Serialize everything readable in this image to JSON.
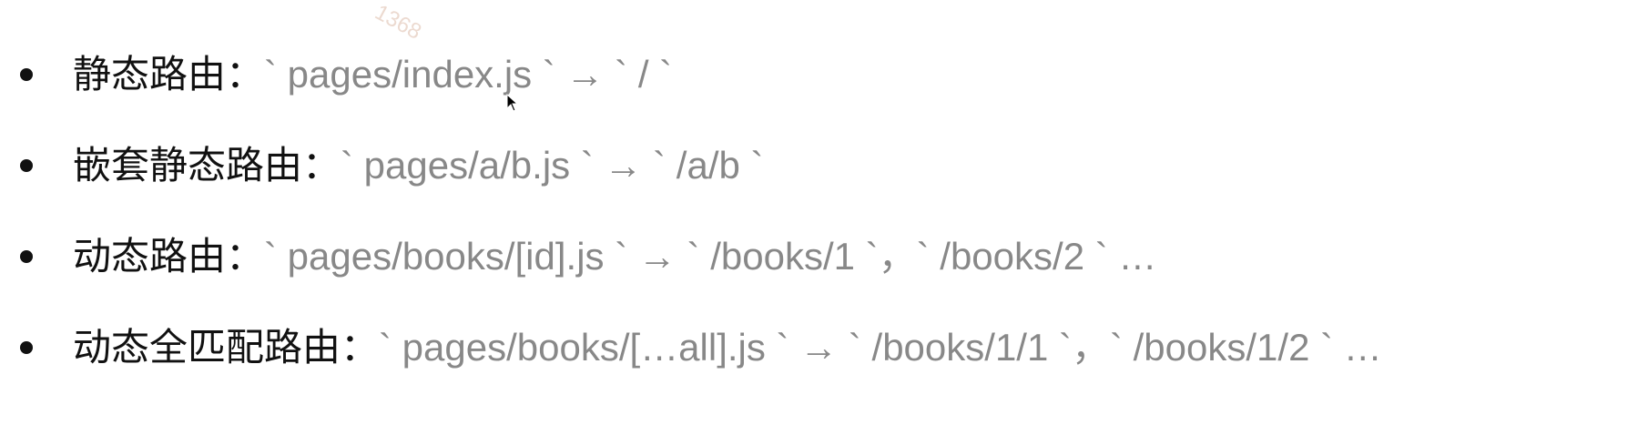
{
  "watermark": "1368",
  "items": [
    {
      "label": "静态路由：",
      "code": "` pages/index.js `  →  ` / `"
    },
    {
      "label": "嵌套静态路由：",
      "code": "` pages/a/b.js `  →  ` /a/b `"
    },
    {
      "label": "动态路由：",
      "code": "` pages/books/[id].js `  →  ` /books/1 `，` /books/2 ` …"
    },
    {
      "label": "动态全匹配路由：",
      "code": "` pages/books/[…all].js `  →  ` /books/1/1 `，` /books/1/2 ` …"
    }
  ]
}
